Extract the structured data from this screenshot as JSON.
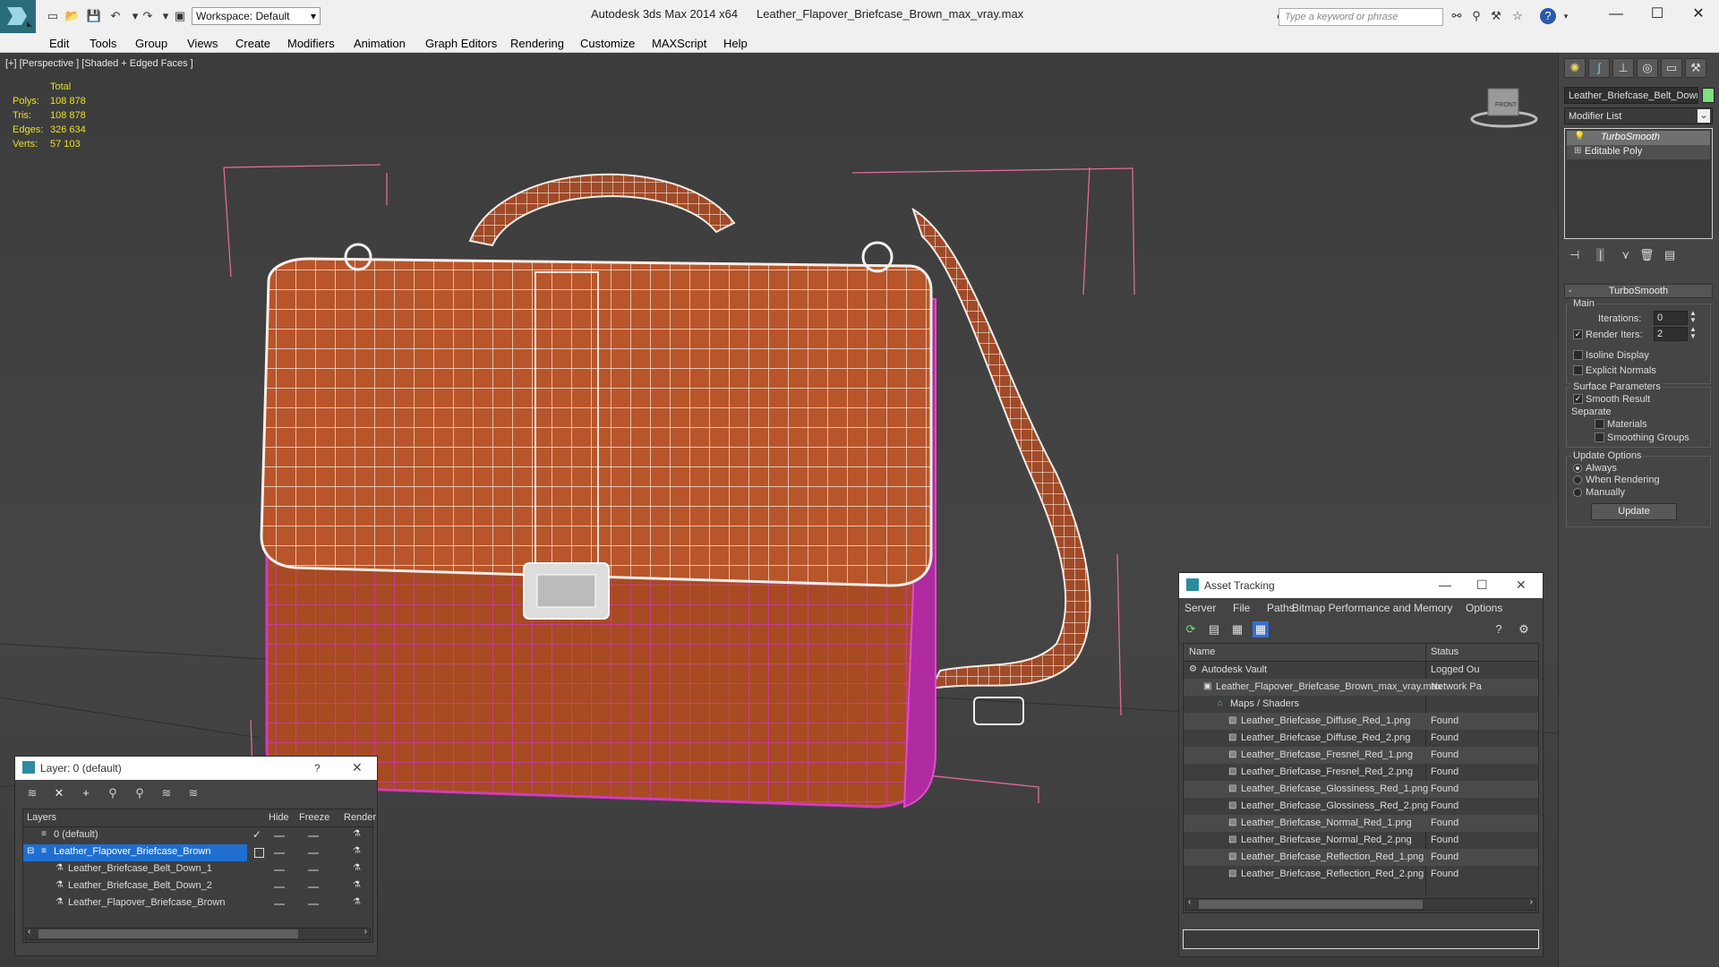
{
  "app": {
    "window_title": "Autodesk 3ds Max  2014 x64",
    "file_title": "Leather_Flapover_Briefcase_Brown_max_vray.max",
    "workspace": "Workspace: Default",
    "search_placeholder": "Type a keyword or phrase"
  },
  "menu": [
    "Edit",
    "Tools",
    "Group",
    "Views",
    "Create",
    "Modifiers",
    "Animation",
    "Graph Editors",
    "Rendering",
    "Customize",
    "MAXScript",
    "Help"
  ],
  "viewport": {
    "label": "[+] [Perspective ] [Shaded + Edged Faces ]",
    "stats_header": "Total",
    "stats": [
      {
        "label": "Polys:",
        "value": "108 878"
      },
      {
        "label": "Tris:",
        "value": "108 878"
      },
      {
        "label": "Edges:",
        "value": "326 634"
      },
      {
        "label": "Verts:",
        "value": "57 103"
      }
    ],
    "viewcube_label": "FRONT"
  },
  "command_panel": {
    "object_name": "Leather_Briefcase_Belt_Down",
    "object_color": "#7ee07e",
    "modifier_list": "Modifier List",
    "stack": [
      "TurboSmooth",
      "Editable Poly"
    ],
    "rollout_title": "TurboSmooth",
    "main_label": "Main",
    "iterations_label": "Iterations:",
    "iterations_value": "0",
    "render_iters_label": "Render Iters:",
    "render_iters_value": "2",
    "isoline_label": "Isoline Display",
    "explicit_normals_label": "Explicit Normals",
    "surface_params_label": "Surface Parameters",
    "smooth_result_label": "Smooth Result",
    "separate_label": "Separate",
    "materials_label": "Materials",
    "smoothing_groups_label": "Smoothing Groups",
    "update_options_label": "Update Options",
    "always_label": "Always",
    "when_rendering_label": "When Rendering",
    "manually_label": "Manually",
    "update_button": "Update"
  },
  "layer_panel": {
    "title": "Layer: 0 (default)",
    "help": "?",
    "columns": [
      "Layers",
      "Hide",
      "Freeze",
      "Render"
    ],
    "rows": [
      {
        "name": "0 (default)"
      },
      {
        "name": "Leather_Flapover_Briefcase_Brown"
      },
      {
        "name": "Leather_Briefcase_Belt_Down_1"
      },
      {
        "name": "Leather_Briefcase_Belt_Down_2"
      },
      {
        "name": "Leather_Flapover_Briefcase_Brown"
      }
    ]
  },
  "asset_tracking": {
    "title": "Asset Tracking",
    "menu": [
      "Server",
      "File",
      "Paths",
      "Bitmap Performance and Memory",
      "Options"
    ],
    "columns": [
      "Name",
      "Status"
    ],
    "rows": [
      {
        "name": "Autodesk Vault",
        "status": "Logged Ou"
      },
      {
        "name": "Leather_Flapover_Briefcase_Brown_max_vray.max",
        "status": "Network Pa"
      },
      {
        "name": "Maps / Shaders",
        "status": ""
      },
      {
        "name": "Leather_Briefcase_Diffuse_Red_1.png",
        "status": "Found"
      },
      {
        "name": "Leather_Briefcase_Diffuse_Red_2.png",
        "status": "Found"
      },
      {
        "name": "Leather_Briefcase_Fresnel_Red_1.png",
        "status": "Found"
      },
      {
        "name": "Leather_Briefcase_Fresnel_Red_2.png",
        "status": "Found"
      },
      {
        "name": "Leather_Briefcase_Glossiness_Red_1.png",
        "status": "Found"
      },
      {
        "name": "Leather_Briefcase_Glossiness_Red_2.png",
        "status": "Found"
      },
      {
        "name": "Leather_Briefcase_Normal_Red_1.png",
        "status": "Found"
      },
      {
        "name": "Leather_Briefcase_Normal_Red_2.png",
        "status": "Found"
      },
      {
        "name": "Leather_Briefcase_Reflection_Red_1.png",
        "status": "Found"
      },
      {
        "name": "Leather_Briefcase_Reflection_Red_2.png",
        "status": "Found"
      }
    ]
  }
}
